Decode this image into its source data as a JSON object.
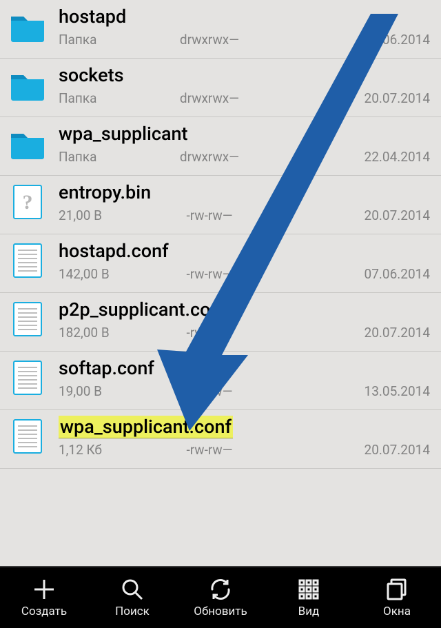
{
  "labels": {
    "folder_type": "Папка"
  },
  "files": [
    {
      "name": "hostapd",
      "kind": "folder",
      "sub": "Папка",
      "perm": "drwxrwx—",
      "date": "07.06.2014",
      "highlight": false,
      "icon": "folder"
    },
    {
      "name": "sockets",
      "kind": "folder",
      "sub": "Папка",
      "perm": "drwxrwx—",
      "date": "20.07.2014",
      "highlight": false,
      "icon": "folder"
    },
    {
      "name": "wpa_supplicant",
      "kind": "folder",
      "sub": "Папка",
      "perm": "drwxrwx—",
      "date": "22.04.2014",
      "highlight": false,
      "icon": "folder"
    },
    {
      "name": "entropy.bin",
      "kind": "file",
      "sub": "21,00 B",
      "perm": "-rw-rw—",
      "date": "20.07.2014",
      "highlight": false,
      "icon": "file-unknown"
    },
    {
      "name": "hostapd.conf",
      "kind": "file",
      "sub": "142,00 B",
      "perm": "-rw-rw—",
      "date": "07.06.2014",
      "highlight": false,
      "icon": "file-text"
    },
    {
      "name": "p2p_supplicant.conf",
      "kind": "file",
      "sub": "182,00 B",
      "perm": "-rw-rw—",
      "date": "20.07.2014",
      "highlight": false,
      "icon": "file-text"
    },
    {
      "name": "softap.conf",
      "kind": "file",
      "sub": "19,00 B",
      "perm": "-rw-rw—",
      "date": "13.05.2014",
      "highlight": false,
      "icon": "file-text"
    },
    {
      "name": "wpa_supplicant.conf",
      "kind": "file",
      "sub": "1,12 Кб",
      "perm": "-rw-rw—",
      "date": "20.07.2014",
      "highlight": true,
      "icon": "file-text"
    }
  ],
  "toolbar": {
    "create": "Создать",
    "search": "Поиск",
    "refresh": "Обновить",
    "view": "Вид",
    "windows": "Окна"
  },
  "colors": {
    "accent": "#1aaee0",
    "arrow": "#1f5ea8"
  }
}
